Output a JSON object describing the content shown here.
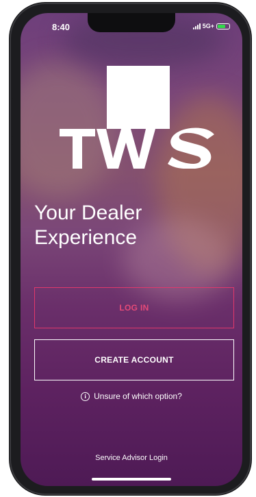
{
  "status_bar": {
    "time": "8:40",
    "network": "5G+"
  },
  "brand": {
    "logo_text": "TWS"
  },
  "headline": {
    "line1": "Your Dealer",
    "line2": "Experience"
  },
  "actions": {
    "login_label": "LOG IN",
    "create_label": "CREATE ACCOUNT",
    "help_text": "Unsure of which option?",
    "advisor_link": "Service Advisor Login"
  },
  "colors": {
    "accent": "#e2386b",
    "background": "#6a2f6a",
    "battery": "#32d74b"
  },
  "icons": {
    "info": "info-icon",
    "signal": "signal-icon",
    "battery": "battery-icon"
  }
}
